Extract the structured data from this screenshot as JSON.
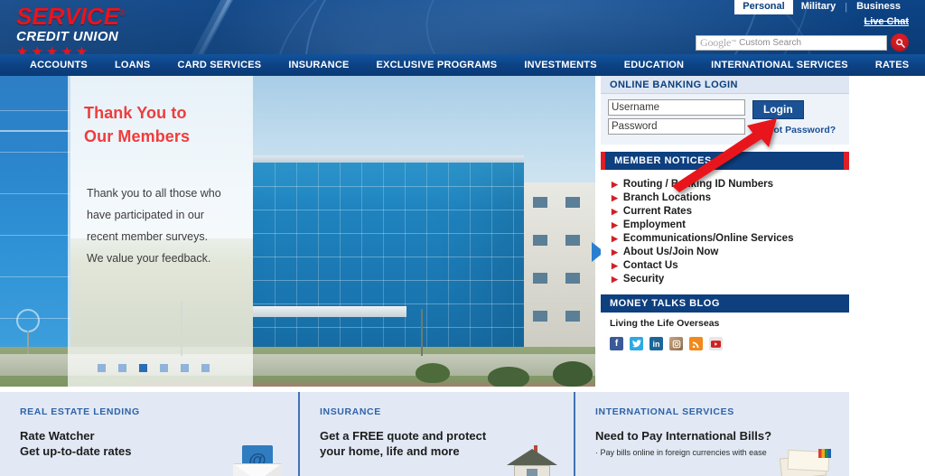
{
  "brand": {
    "name_top": "SERVICE",
    "registered": "®",
    "name_bottom": "CREDIT UNION",
    "stars": "★★★★★"
  },
  "header": {
    "audience_tabs": [
      {
        "label": "Personal",
        "active": true
      },
      {
        "label": "Military",
        "active": false
      },
      {
        "label": "Business",
        "active": false
      }
    ],
    "separator": "|",
    "live_chat": "Live Chat",
    "search": {
      "google_word": "Google",
      "trademark": "™",
      "placeholder": "Custom Search",
      "button_icon": "search-icon"
    }
  },
  "nav": {
    "items": [
      "ACCOUNTS",
      "LOANS",
      "CARD SERVICES",
      "INSURANCE",
      "EXCLUSIVE PROGRAMS",
      "INVESTMENTS",
      "EDUCATION",
      "INTERNATIONAL SERVICES",
      "RATES"
    ]
  },
  "hero": {
    "title_line1": "Thank You to",
    "title_line2": "Our Members",
    "body_line1": "Thank you to all those who",
    "body_line2": "have participated in our",
    "body_line3": "recent member surveys.",
    "body_line4": "We value your feedback.",
    "dots_count": 6,
    "active_dot": 3,
    "next_icon": "chevron-right-icon",
    "title_color": "#ef3c3c"
  },
  "login": {
    "heading": "ONLINE BANKING LOGIN",
    "username_value": "Username",
    "password_value": "Password",
    "login_button": "Login",
    "forgot_link": "Forgot Password?"
  },
  "member_notices": {
    "heading": "MEMBER NOTICES",
    "items": [
      "Routing / Banking ID Numbers",
      "Branch Locations",
      "Current Rates",
      "Employment",
      "Ecommunications/Online Services",
      "About Us/Join Now",
      "Contact Us",
      "Security"
    ]
  },
  "blog": {
    "heading": "MONEY TALKS BLOG",
    "post_title": "Living the Life Overseas",
    "social": [
      {
        "name": "facebook-icon",
        "glyph": "f"
      },
      {
        "name": "twitter-icon",
        "glyph": "t"
      },
      {
        "name": "linkedin-icon",
        "glyph": "in"
      },
      {
        "name": "instagram-icon",
        "glyph": "◉"
      },
      {
        "name": "rss-icon",
        "glyph": "❯"
      },
      {
        "name": "youtube-icon",
        "glyph": "▶"
      }
    ]
  },
  "promos": [
    {
      "kicker": "REAL ESTATE LENDING",
      "title_line1": "Rate Watcher",
      "title_line2": "Get up-to-date rates",
      "sub": "",
      "art": "envelope-at-icon"
    },
    {
      "kicker": "INSURANCE",
      "title_line1": "Get a FREE quote and protect",
      "title_line2": "your home, life and more",
      "sub": "",
      "art": "house-icon"
    },
    {
      "kicker": "INTERNATIONAL SERVICES",
      "title_line1": "Need to Pay International Bills?",
      "title_line2": "",
      "sub": "· Pay bills online in foreign currencies with ease",
      "art": "airmail-letters-icon"
    }
  ],
  "annotation": {
    "type": "red-arrow",
    "color": "#e8121a",
    "points_to": "Forgot Password?"
  },
  "colors": {
    "header_blue": "#0b3f7e",
    "nav_blue": "#0c4183",
    "brand_red": "#e8141e",
    "accent_red": "#e01e26",
    "panel_bg": "#e2e9f5"
  }
}
